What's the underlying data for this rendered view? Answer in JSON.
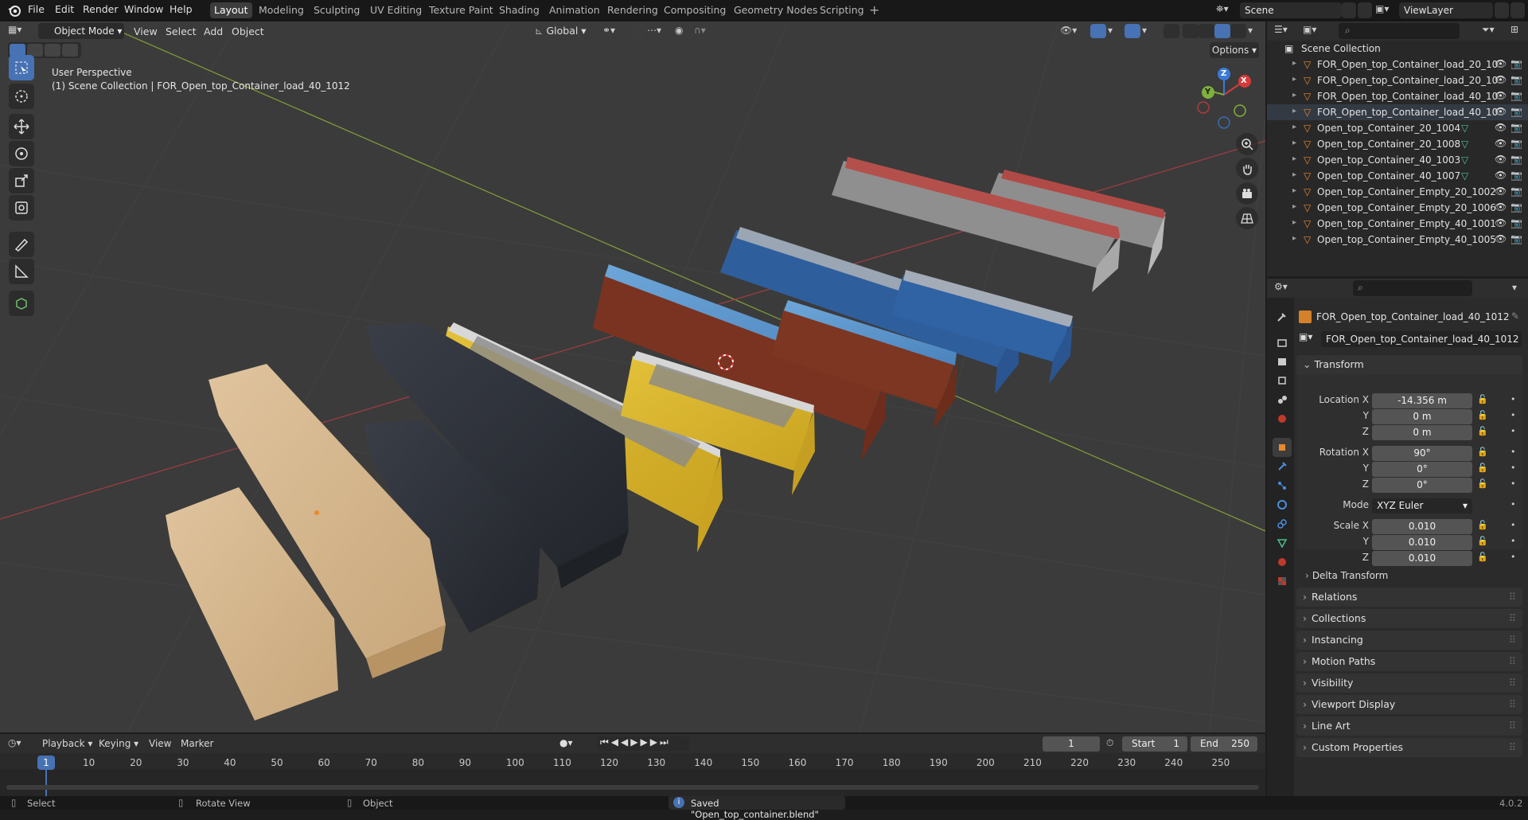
{
  "app": {
    "menus": [
      "File",
      "Edit",
      "Render",
      "Window",
      "Help"
    ],
    "workspaces": [
      "Layout",
      "Modeling",
      "Sculpting",
      "UV Editing",
      "Texture Paint",
      "Shading",
      "Animation",
      "Rendering",
      "Compositing",
      "Geometry Nodes",
      "Scripting"
    ],
    "active_workspace": "Layout",
    "scene": "Scene",
    "view_layer": "ViewLayer",
    "version": "4.0.2"
  },
  "viewport": {
    "mode": "Object Mode",
    "menus": [
      "View",
      "Select",
      "Add",
      "Object"
    ],
    "orientation": "Global",
    "options_label": "Options",
    "perspective_label": "User Perspective",
    "context_label": "(1) Scene Collection | FOR_Open_top_Container_load_40_1012",
    "gizmo_axes": {
      "x": "X",
      "y": "Y",
      "z": "Z"
    }
  },
  "outliner": {
    "root": "Scene Collection",
    "items": [
      {
        "name": "FOR_Open_top_Container_load_20_10",
        "type": "object"
      },
      {
        "name": "FOR_Open_top_Container_load_20_10",
        "type": "object"
      },
      {
        "name": "FOR_Open_top_Container_load_40_10",
        "type": "object"
      },
      {
        "name": "FOR_Open_top_Container_load_40_10",
        "type": "object-selected"
      },
      {
        "name": "Open_top_Container_20_1004",
        "type": "mesh"
      },
      {
        "name": "Open_top_Container_20_1008",
        "type": "mesh"
      },
      {
        "name": "Open_top_Container_40_1003",
        "type": "mesh"
      },
      {
        "name": "Open_top_Container_40_1007",
        "type": "mesh"
      },
      {
        "name": "Open_top_Container_Empty_20_1002",
        "type": "object"
      },
      {
        "name": "Open_top_Container_Empty_20_1006",
        "type": "object"
      },
      {
        "name": "Open_top_Container_Empty_40_1001",
        "type": "object"
      },
      {
        "name": "Open_top_Container_Empty_40_1005",
        "type": "object"
      }
    ]
  },
  "properties": {
    "object_name": "FOR_Open_top_Container_load_40_1012",
    "datablock_name": "FOR_Open_top_Container_load_40_1012",
    "transform": {
      "title": "Transform",
      "location_label": "Location X",
      "location": [
        "-14.356 m",
        "0 m",
        "0 m"
      ],
      "rotation_label": "Rotation X",
      "rotation": [
        "90°",
        "0°",
        "0°"
      ],
      "mode_label": "Mode",
      "mode": "XYZ Euler",
      "scale_label": "Scale X",
      "scale": [
        "0.010",
        "0.010",
        "0.010"
      ],
      "axis_y": "Y",
      "axis_z": "Z",
      "delta": "Delta Transform"
    },
    "panels": [
      "Relations",
      "Collections",
      "Instancing",
      "Motion Paths",
      "Visibility",
      "Viewport Display",
      "Line Art",
      "Custom Properties"
    ]
  },
  "timeline": {
    "menus": [
      "Playback",
      "Keying",
      "View",
      "Marker"
    ],
    "current_frame": "1",
    "start_label": "Start",
    "start": "1",
    "end_label": "End",
    "end": "250",
    "ticks": [
      "10",
      "20",
      "30",
      "40",
      "50",
      "60",
      "70",
      "80",
      "90",
      "100",
      "110",
      "120",
      "130",
      "140",
      "150",
      "160",
      "170",
      "180",
      "190",
      "200",
      "210",
      "220",
      "230",
      "240",
      "250"
    ]
  },
  "status": {
    "select": "Select",
    "rotate": "Rotate View",
    "object": "Object",
    "message": "Saved \"Open_top_container.blend\""
  },
  "colors": {
    "accent": "#4772b3",
    "selected_orange": "#e8892b",
    "container_yellow": "#d9b62e",
    "container_blue": "#2f5f9e",
    "container_rust": "#8c3a22",
    "container_red": "#b34a48",
    "tarp_blue": "#5b93c8",
    "sand": "#d2b48c",
    "coal": "#2c3038"
  }
}
